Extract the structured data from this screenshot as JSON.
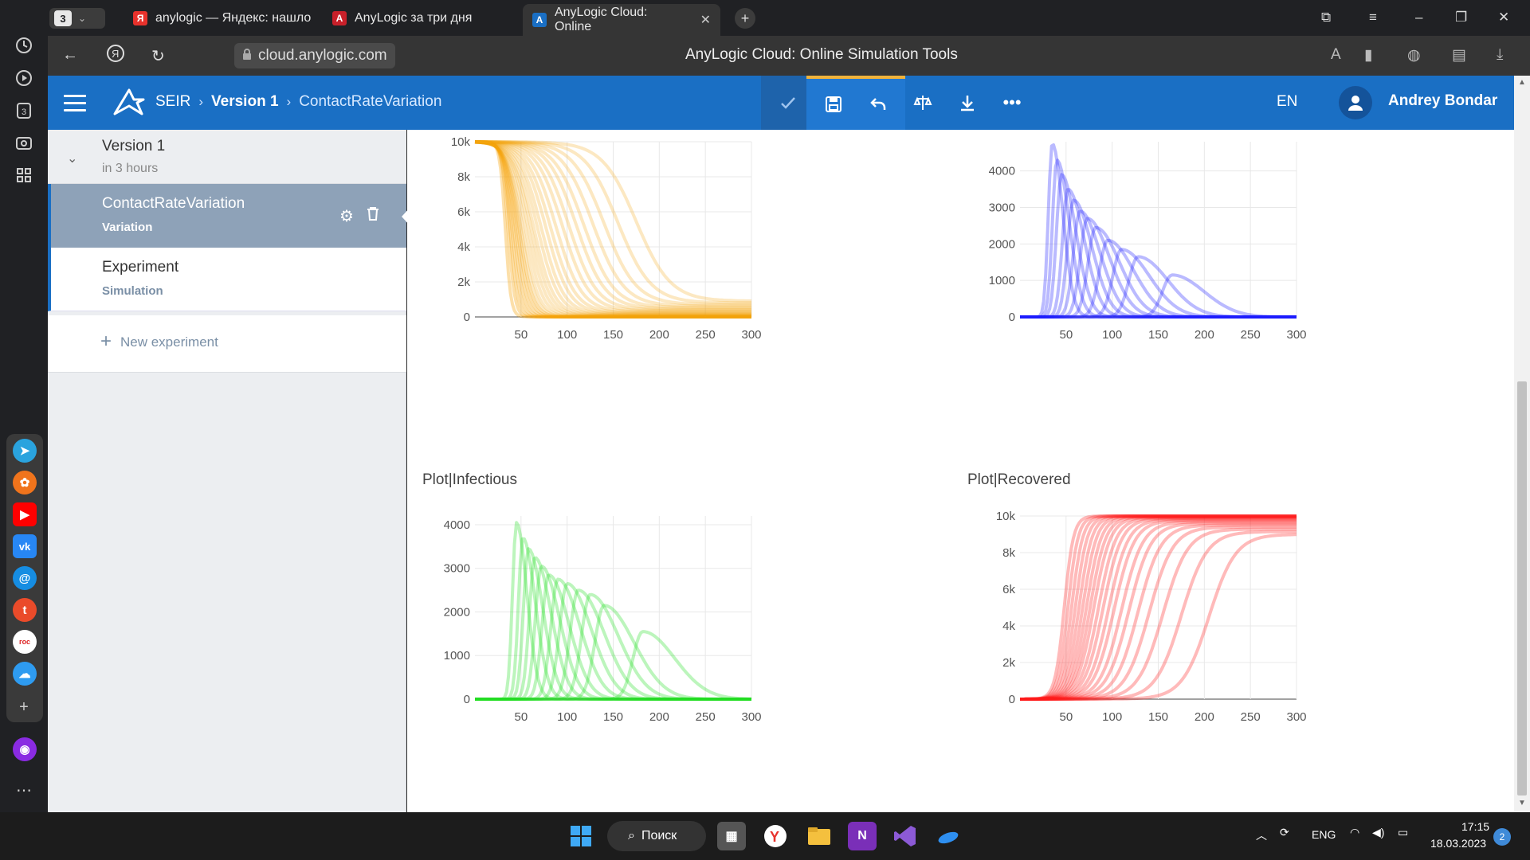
{
  "browser": {
    "tab_count": "3",
    "tabs": [
      {
        "title": "anylogic — Яндекс: нашло",
        "favicon": "Я",
        "favicon_color": "#e8322c"
      },
      {
        "title": "AnyLogic за три дня",
        "favicon": "A",
        "favicon_color": "#c8202a"
      },
      {
        "title": "AnyLogic Cloud: Online",
        "favicon": "A",
        "favicon_color": "#1a6fc4",
        "close": "✕"
      }
    ],
    "url": "cloud.anylogic.com",
    "page_title": "AnyLogic Cloud: Online Simulation Tools"
  },
  "header": {
    "crumbs": [
      "SEIR",
      "Version 1",
      "ContactRateVariation"
    ],
    "lang": "EN",
    "user": "Andrey Bondar",
    "accent_color": "#1a6fc4",
    "highlight_color": "#f0b23a"
  },
  "sidebar": {
    "version_title": "Version 1",
    "version_time": "in 3 hours",
    "experiments": [
      {
        "title": "ContactRateVariation",
        "type": "Variation"
      },
      {
        "title": "Experiment",
        "type": "Simulation"
      }
    ],
    "new_experiment": "New experiment"
  },
  "charts": {
    "infectious_title": "Plot|Infectious",
    "recovered_title": "Plot|Recovered"
  },
  "chart_data": [
    {
      "type": "line",
      "id": "susceptible",
      "color": "#f5a20a",
      "x_ticks": [
        50,
        100,
        150,
        200,
        250,
        300
      ],
      "y_ticks": [
        "0",
        "2k",
        "4k",
        "6k",
        "8k",
        "10k"
      ],
      "xlim": [
        0,
        300
      ],
      "ylim": [
        0,
        10000
      ],
      "grid": true,
      "series_shape": "decreasing sigmoid",
      "runs": 30,
      "midpoints_x": [
        33,
        36,
        38,
        40,
        42,
        44,
        46,
        48,
        50,
        52,
        55,
        58,
        61,
        64,
        68,
        72,
        77,
        82,
        88,
        95,
        102,
        110,
        118,
        128,
        140,
        155,
        175
      ],
      "final_min": 0,
      "final_max": 900,
      "start_value": 10000
    },
    {
      "type": "line",
      "id": "exposed",
      "color": "#1a1aff",
      "x_ticks": [
        50,
        100,
        150,
        200,
        250,
        300
      ],
      "y_ticks": [
        "0",
        "1000",
        "2000",
        "3000",
        "4000"
      ],
      "xlim": [
        0,
        300
      ],
      "ylim": [
        0,
        4800
      ],
      "grid": true,
      "series_shape": "peak",
      "peaks": [
        [
          35,
          4750
        ],
        [
          40,
          4300
        ],
        [
          45,
          3900
        ],
        [
          52,
          3500
        ],
        [
          58,
          3200
        ],
        [
          65,
          2900
        ],
        [
          73,
          2700
        ],
        [
          82,
          2450
        ],
        [
          95,
          2100
        ],
        [
          110,
          1850
        ],
        [
          128,
          1650
        ],
        [
          165,
          1150
        ]
      ]
    },
    {
      "type": "line",
      "id": "infectious",
      "title": "Plot|Infectious",
      "color": "#22dd22",
      "x_ticks": [
        50,
        100,
        150,
        200,
        250,
        300
      ],
      "y_ticks": [
        "0",
        "1000",
        "2000",
        "3000",
        "4000"
      ],
      "xlim": [
        0,
        300
      ],
      "ylim": [
        0,
        4200
      ],
      "grid": true,
      "series_shape": "peak",
      "peaks": [
        [
          45,
          4050
        ],
        [
          52,
          3700
        ],
        [
          58,
          3450
        ],
        [
          65,
          3250
        ],
        [
          72,
          3050
        ],
        [
          80,
          2850
        ],
        [
          90,
          2750
        ],
        [
          100,
          2650
        ],
        [
          112,
          2500
        ],
        [
          125,
          2400
        ],
        [
          140,
          2150
        ],
        [
          182,
          1550
        ]
      ]
    },
    {
      "type": "line",
      "id": "recovered",
      "title": "Plot|Recovered",
      "color": "#ff1a1a",
      "x_ticks": [
        50,
        100,
        150,
        200,
        250,
        300
      ],
      "y_ticks": [
        "0",
        "2k",
        "4k",
        "6k",
        "8k",
        "10k"
      ],
      "xlim": [
        0,
        300
      ],
      "ylim": [
        0,
        10000
      ],
      "grid": true,
      "series_shape": "increasing sigmoid",
      "midpoints_x": [
        48,
        52,
        56,
        60,
        64,
        68,
        72,
        76,
        80,
        85,
        90,
        96,
        102,
        110,
        118,
        128,
        140,
        155,
        175,
        205
      ],
      "final_min": 9000,
      "final_max": 10000
    }
  ],
  "taskbar": {
    "search": "Поиск",
    "lang": "ENG",
    "time": "17:15",
    "date": "18.03.2023",
    "notifications": "2"
  }
}
